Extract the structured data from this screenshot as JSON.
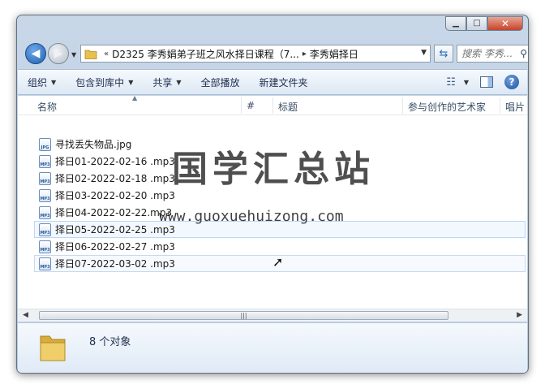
{
  "window": {
    "minimize_label": "▁",
    "maximize_label": "□",
    "close_label": "✕"
  },
  "navigation": {
    "back_label": "◀",
    "forward_label": "▶",
    "address_prefix": "«",
    "breadcrumbs": [
      "D2325 李秀娟弟子班之风水择日课程（7...",
      "李秀娟择日"
    ],
    "search_placeholder": "搜索 李秀..."
  },
  "toolbar": {
    "items": [
      "组织",
      "包含到库中",
      "共享",
      "全部播放",
      "新建文件夹"
    ],
    "dropdown_items": [
      true,
      true,
      true,
      false,
      false
    ]
  },
  "columns": [
    "名称",
    "#",
    "标题",
    "参与创作的艺术家",
    "唱片"
  ],
  "files": [
    {
      "name": "寻找丢失物品.jpg",
      "type": "JPG"
    },
    {
      "name": "择日01-2022-02-16 .mp3",
      "type": "MP3"
    },
    {
      "name": "择日02-2022-02-18 .mp3",
      "type": "MP3"
    },
    {
      "name": "择日03-2022-02-20 .mp3",
      "type": "MP3"
    },
    {
      "name": "择日04-2022-02-22.mp3",
      "type": "MP3"
    },
    {
      "name": "择日05-2022-02-25 .mp3",
      "type": "MP3"
    },
    {
      "name": "择日06-2022-02-27 .mp3",
      "type": "MP3"
    },
    {
      "name": "择日07-2022-03-02 .mp3",
      "type": "MP3"
    }
  ],
  "watermark": {
    "title": "国学汇总站",
    "url": "www.guoxuehuizong.com"
  },
  "status": {
    "count_text": "8 个对象"
  },
  "colors": {
    "accent": "#1f5fb3",
    "selection_border": "#b8d6fb",
    "folder": "#e8c050"
  }
}
